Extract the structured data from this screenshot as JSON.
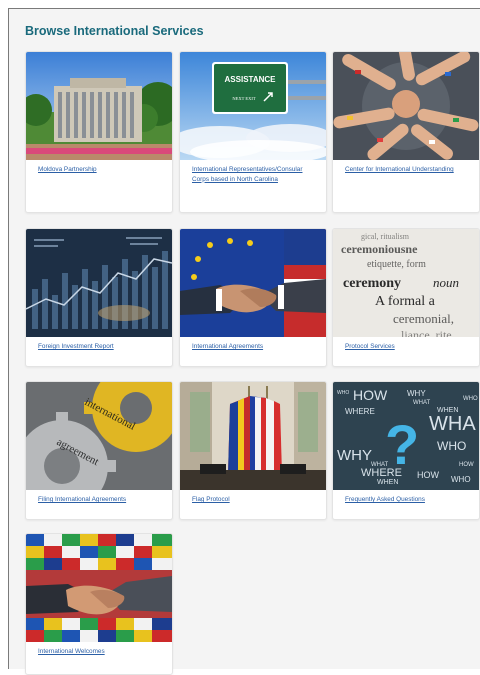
{
  "page": {
    "heading": "Browse International Services"
  },
  "images": {
    "assistance_sign": {
      "line1": "ASSISTANCE",
      "line2": "NEXT EXIT"
    },
    "ceremony_text": {
      "l1": "gical, ritualism",
      "l2": "ceremoniousne",
      "l3": "etiquette, form",
      "l4_bold": "ceremony",
      "l4_italic": "noun",
      "l5": "A formal a",
      "l6": "ceremonial,",
      "l7": "liance, rite,"
    },
    "gear_words": {
      "w1": "international",
      "w2": "agreement"
    },
    "question_words": {
      "how1": "HOW",
      "why1": "WHY",
      "what1": "WHAT",
      "where1": "WHERE",
      "who1": "WHO",
      "when1": "WHEN",
      "wha": "WHA",
      "how2": "HOW",
      "who2": "WHO",
      "why2": "WHY",
      "what2": "WHAT",
      "where2": "WHERE",
      "when2": "WHEN",
      "who3": "WHO",
      "how3": "HOW",
      "who4": "WHO"
    }
  },
  "cards": [
    {
      "label": "Moldova Partnership"
    },
    {
      "label": "International Representatives/Consular Corps based in North Carolina"
    },
    {
      "label": "Center for International Understanding"
    },
    {
      "label": "Foreign Investment Report"
    },
    {
      "label": "International Agreements"
    },
    {
      "label": "Protocol Services"
    },
    {
      "label": "Filing International Agreements"
    },
    {
      "label": "Flag Protocol"
    },
    {
      "label": "Frequently Asked Questions"
    },
    {
      "label": "International Welcomes"
    }
  ]
}
